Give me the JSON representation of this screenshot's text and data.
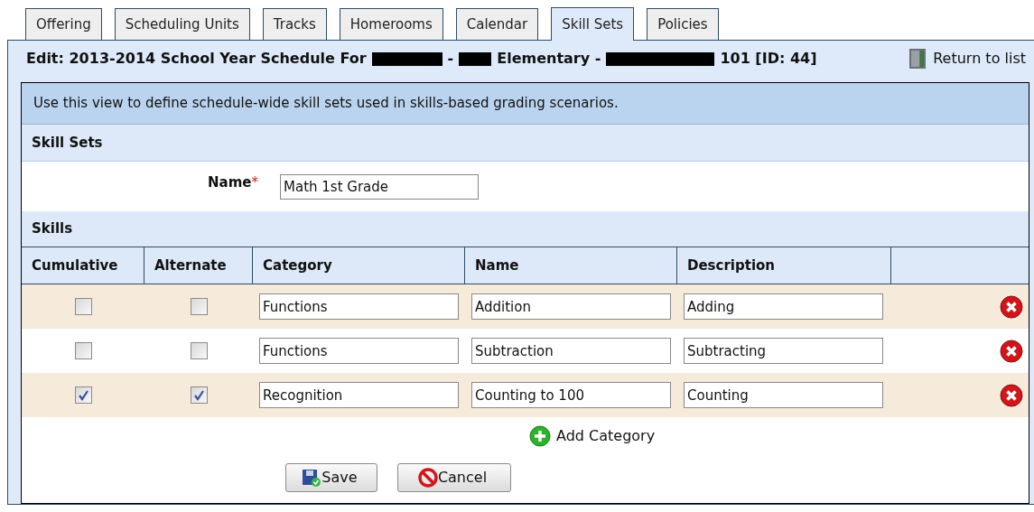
{
  "tabs": [
    {
      "label": "Offering",
      "selected": false
    },
    {
      "label": "Scheduling Units",
      "selected": false
    },
    {
      "label": "Tracks",
      "selected": false
    },
    {
      "label": "Homerooms",
      "selected": false
    },
    {
      "label": "Calendar",
      "selected": false
    },
    {
      "label": "Skill Sets",
      "selected": true
    },
    {
      "label": "Policies",
      "selected": false
    }
  ],
  "title": [
    {
      "kind": "text",
      "text": "Edit: 2013-2014 School Year Schedule For"
    },
    {
      "kind": "redacted"
    },
    {
      "kind": "text",
      "text": "-"
    },
    {
      "kind": "redacted"
    },
    {
      "kind": "text",
      "text": "Elementary -"
    },
    {
      "kind": "redacted"
    },
    {
      "kind": "text",
      "text": "101 [ID: 44]"
    }
  ],
  "return_link": "Return to list",
  "info": "Use this view to define schedule-wide skill sets used in skills-based grading scenarios.",
  "skill_sets_heading": "Skill Sets",
  "name_field": {
    "label": "Name",
    "required_mark": "*",
    "value": "Math 1st Grade"
  },
  "skills_heading": "Skills",
  "table": {
    "columns": [
      "Cumulative",
      "Alternate",
      "Category",
      "Name",
      "Description"
    ],
    "rows": [
      {
        "cumulative": false,
        "alternate": false,
        "category": "Functions",
        "name": "Addition",
        "description": "Adding"
      },
      {
        "cumulative": false,
        "alternate": false,
        "category": "Functions",
        "name": "Subtraction",
        "description": "Subtracting"
      },
      {
        "cumulative": true,
        "alternate": true,
        "category": "Recognition",
        "name": "Counting to 100",
        "description": "Counting"
      }
    ]
  },
  "add_category": "Add Category",
  "buttons": [
    "Save",
    "Cancel"
  ]
}
